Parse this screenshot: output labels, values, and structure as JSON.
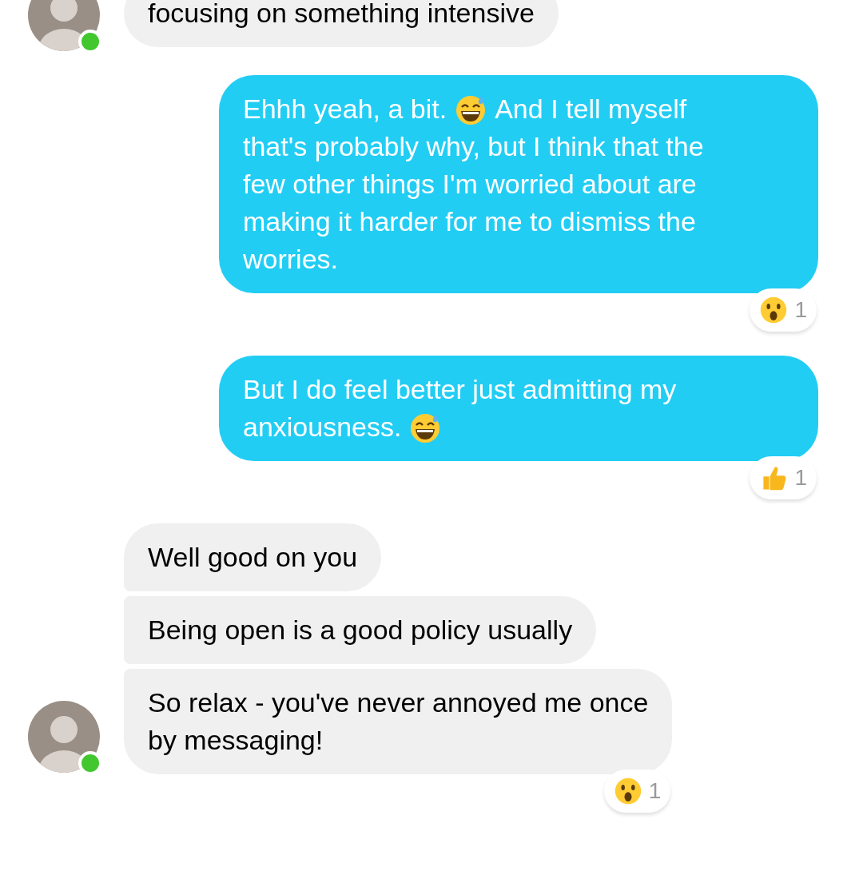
{
  "messages": [
    {
      "kind": "received",
      "avatar": true,
      "online": true,
      "lines": [
        [
          {
            "kind": "text",
            "text": "focusing on something intensive"
          }
        ]
      ]
    },
    {
      "kind": "sent",
      "lines": [
        [
          {
            "kind": "text",
            "text": "Ehhh yeah, a bit."
          },
          {
            "kind": "sweat_smile"
          },
          {
            "kind": "text",
            "text": "And I tell myself"
          }
        ],
        [
          {
            "kind": "text",
            "text": "that's probably why, but I think that the"
          }
        ],
        [
          {
            "kind": "text",
            "text": "few other things I'm worried about are"
          }
        ],
        [
          {
            "kind": "text",
            "text": "making it harder for me to dismiss the"
          }
        ],
        [
          {
            "kind": "text",
            "text": "worries."
          }
        ]
      ],
      "reaction": {
        "kind": "surprised",
        "count": "1"
      }
    },
    {
      "kind": "sent",
      "lines": [
        [
          {
            "kind": "text",
            "text": "But I do feel better just admitting my"
          }
        ],
        [
          {
            "kind": "text",
            "text": "anxiousness."
          },
          {
            "kind": "sweat_smile"
          }
        ]
      ],
      "reaction": {
        "kind": "thumbs_up",
        "count": "1"
      }
    },
    {
      "kind": "received",
      "avatar": false,
      "lines": [
        [
          {
            "kind": "text",
            "text": "Well good on you"
          }
        ]
      ]
    },
    {
      "kind": "received",
      "avatar": false,
      "lines": [
        [
          {
            "kind": "text",
            "text": "Being open is a good policy usually"
          }
        ]
      ]
    },
    {
      "kind": "received",
      "avatar": true,
      "online": true,
      "lines": [
        [
          {
            "kind": "text",
            "text": "So relax - you've never annoyed me once"
          }
        ],
        [
          {
            "kind": "text",
            "text": "by messaging!"
          }
        ]
      ],
      "reaction": {
        "kind": "surprised",
        "count": "1"
      }
    }
  ]
}
